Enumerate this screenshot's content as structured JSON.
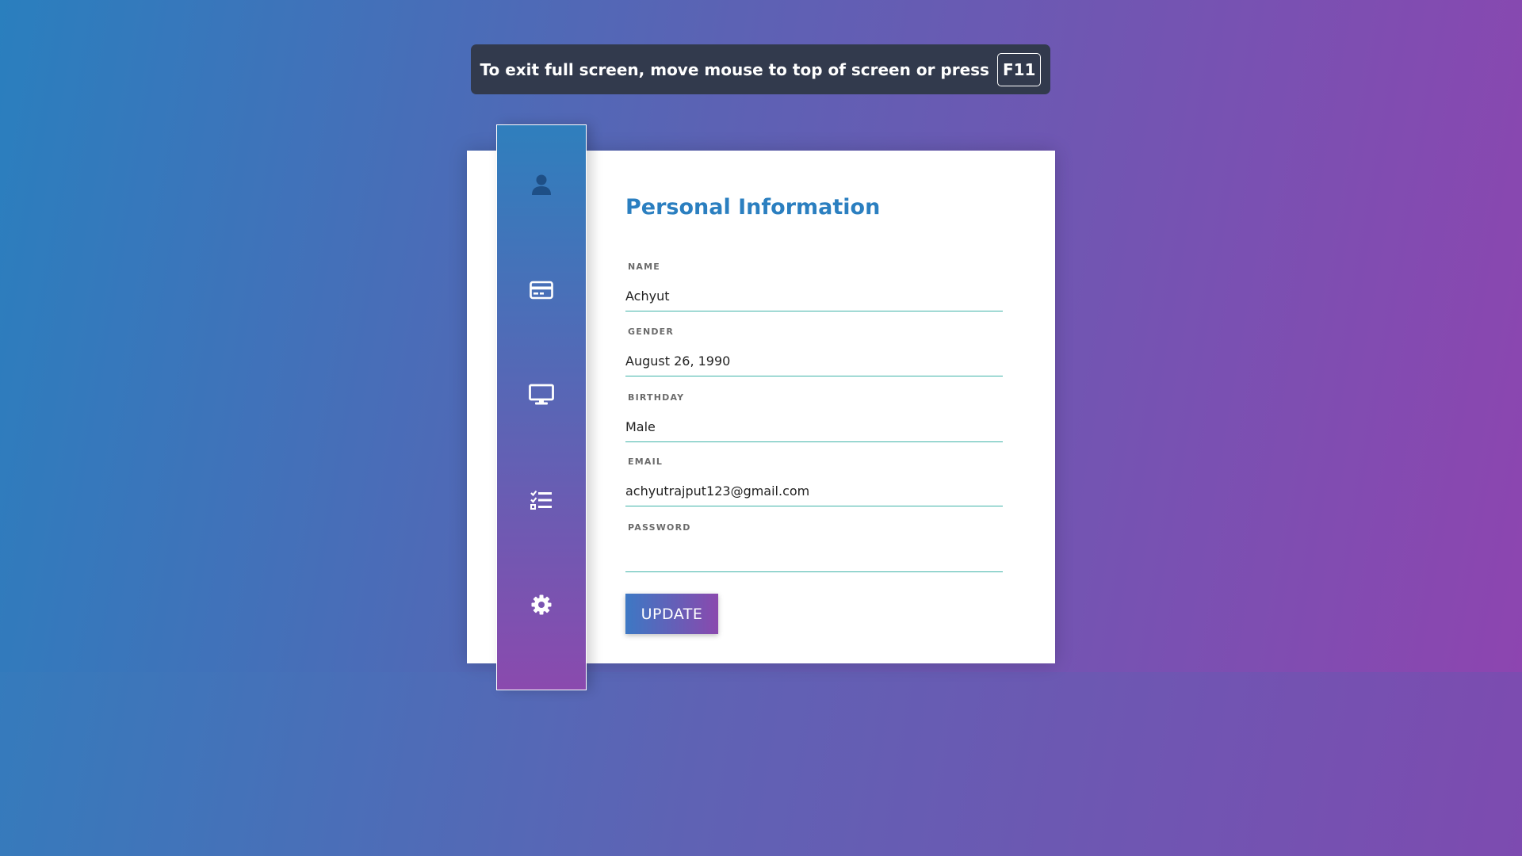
{
  "fullscreen_notice": {
    "message": "To exit full screen, move mouse to top of screen or press",
    "key": "F11"
  },
  "sidebar": {
    "items": [
      {
        "icon": "user-icon",
        "color": "#1e4f86"
      },
      {
        "icon": "credit-card-icon",
        "color": "#ffffff"
      },
      {
        "icon": "monitor-icon",
        "color": "#ffffff"
      },
      {
        "icon": "checklist-icon",
        "color": "#ffffff"
      },
      {
        "icon": "gear-icon",
        "color": "#ffffff"
      }
    ]
  },
  "form": {
    "title": "Personal Information",
    "fields": [
      {
        "label": "NAME",
        "value": "Achyut"
      },
      {
        "label": "GENDER",
        "value": "August 26, 1990"
      },
      {
        "label": "BIRTHDAY",
        "value": "Male"
      },
      {
        "label": "EMAIL",
        "value": "achyutrajput123@gmail.com"
      },
      {
        "label": "PASSWORD",
        "value": ""
      }
    ],
    "submit_label": "UPDATE"
  },
  "colors": {
    "title": "#2b7fc0",
    "underline": "#3fb3a8",
    "banner_bg": "#323a4d"
  }
}
